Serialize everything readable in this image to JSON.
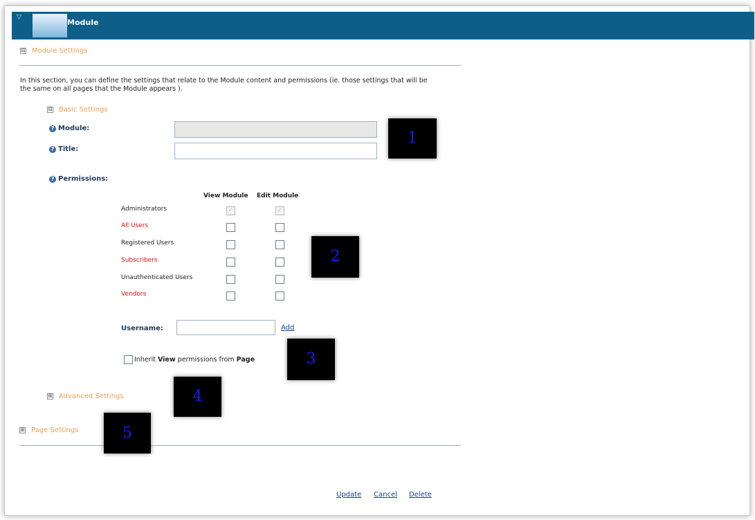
{
  "header": {
    "title": "Module"
  },
  "module_settings": {
    "heading": "Module Settings",
    "toggle_symbol": "⊟",
    "intro": "In this section, you can define the settings that relate to the Module content and permissions (ie. those settings that will be the same on all pages that the Module appears )."
  },
  "basic_settings": {
    "heading": "Basic Settings",
    "toggle_symbol": "⊟",
    "module_label": "Module:",
    "module_value": "",
    "title_label": "Title:",
    "title_value": "",
    "permissions_label": "Permissions:"
  },
  "permissions": {
    "col_view": "View Module",
    "col_edit": "Edit Module",
    "roles": [
      {
        "name": "Administrators",
        "color": "#222222",
        "view": true,
        "edit": true,
        "disabled": true
      },
      {
        "name": "All Users",
        "color": "#cc1111",
        "view": false,
        "edit": false,
        "disabled": false
      },
      {
        "name": "Registered Users",
        "color": "#222222",
        "view": false,
        "edit": false,
        "disabled": false
      },
      {
        "name": "Subscribers",
        "color": "#cc1111",
        "view": false,
        "edit": false,
        "disabled": false
      },
      {
        "name": "Unauthenticated Users",
        "color": "#222222",
        "view": false,
        "edit": false,
        "disabled": false
      },
      {
        "name": "Vendors",
        "color": "#cc1111",
        "view": false,
        "edit": false,
        "disabled": false
      }
    ],
    "username_label": "Username:",
    "username_value": "",
    "add_link": "Add",
    "inherit": {
      "prefix": "Inherit ",
      "bold1": "View",
      "middle": " permissions from ",
      "bold2": "Page",
      "checked": false
    }
  },
  "advanced_settings": {
    "heading": "Advanced Settings",
    "toggle_symbol": "⊞"
  },
  "page_settings": {
    "heading": "Page Settings",
    "toggle_symbol": "⊞"
  },
  "actions": {
    "update": "Update",
    "cancel": "Cancel",
    "delete": "Delete"
  },
  "markers": [
    "1",
    "2",
    "3",
    "4",
    "5"
  ],
  "colors": {
    "header": "#0d5f8a",
    "section_heading": "#f0a050",
    "link": "#1b3f8b",
    "marker_text": "#1a1aff"
  }
}
